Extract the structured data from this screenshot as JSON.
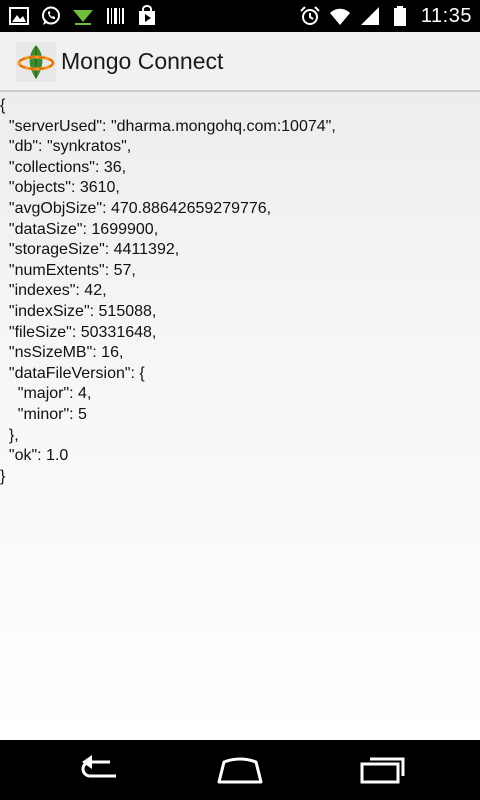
{
  "status_bar": {
    "time": "11:35",
    "left_icons": [
      "image-icon",
      "whatsapp-icon",
      "download-icon",
      "barcode-icon",
      "play-store-icon"
    ],
    "right_icons": [
      "alarm-icon",
      "wifi-icon",
      "signal-icon",
      "battery-icon"
    ]
  },
  "action_bar": {
    "title": "Mongo Connect"
  },
  "json_lines": [
    "{",
    "  \"serverUsed\": \"dharma.mongohq.com:10074\",",
    "  \"db\": \"synkratos\",",
    "  \"collections\": 36,",
    "  \"objects\": 3610,",
    "  \"avgObjSize\": 470.88642659279776,",
    "  \"dataSize\": 1699900,",
    "  \"storageSize\": 4411392,",
    "  \"numExtents\": 57,",
    "  \"indexes\": 42,",
    "  \"indexSize\": 515088,",
    "  \"fileSize\": 50331648,",
    "  \"nsSizeMB\": 16,",
    "  \"dataFileVersion\": {",
    "    \"major\": 4,",
    "    \"minor\": 5",
    "  },",
    "  \"ok\": 1.0",
    "}"
  ],
  "nav_bar": {
    "buttons": [
      "back-icon",
      "home-icon",
      "recent-apps-icon"
    ]
  }
}
